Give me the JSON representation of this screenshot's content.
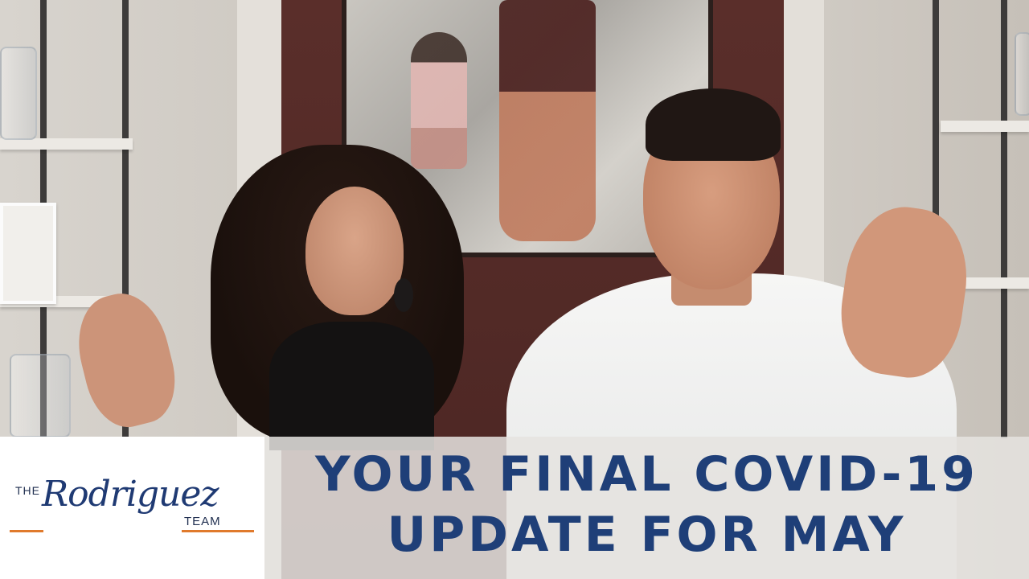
{
  "scene": {
    "subject": "two people waving in front of a painting"
  },
  "logo": {
    "prefix": "THE",
    "name": "Rodriguez",
    "suffix": "TEAM",
    "accent_color": "#e07a2c",
    "text_color": "#1f3a73"
  },
  "title": {
    "line1": "YOUR FINAL COVID-19",
    "line2": "UPDATE FOR MAY",
    "color": "#1f3f78"
  }
}
